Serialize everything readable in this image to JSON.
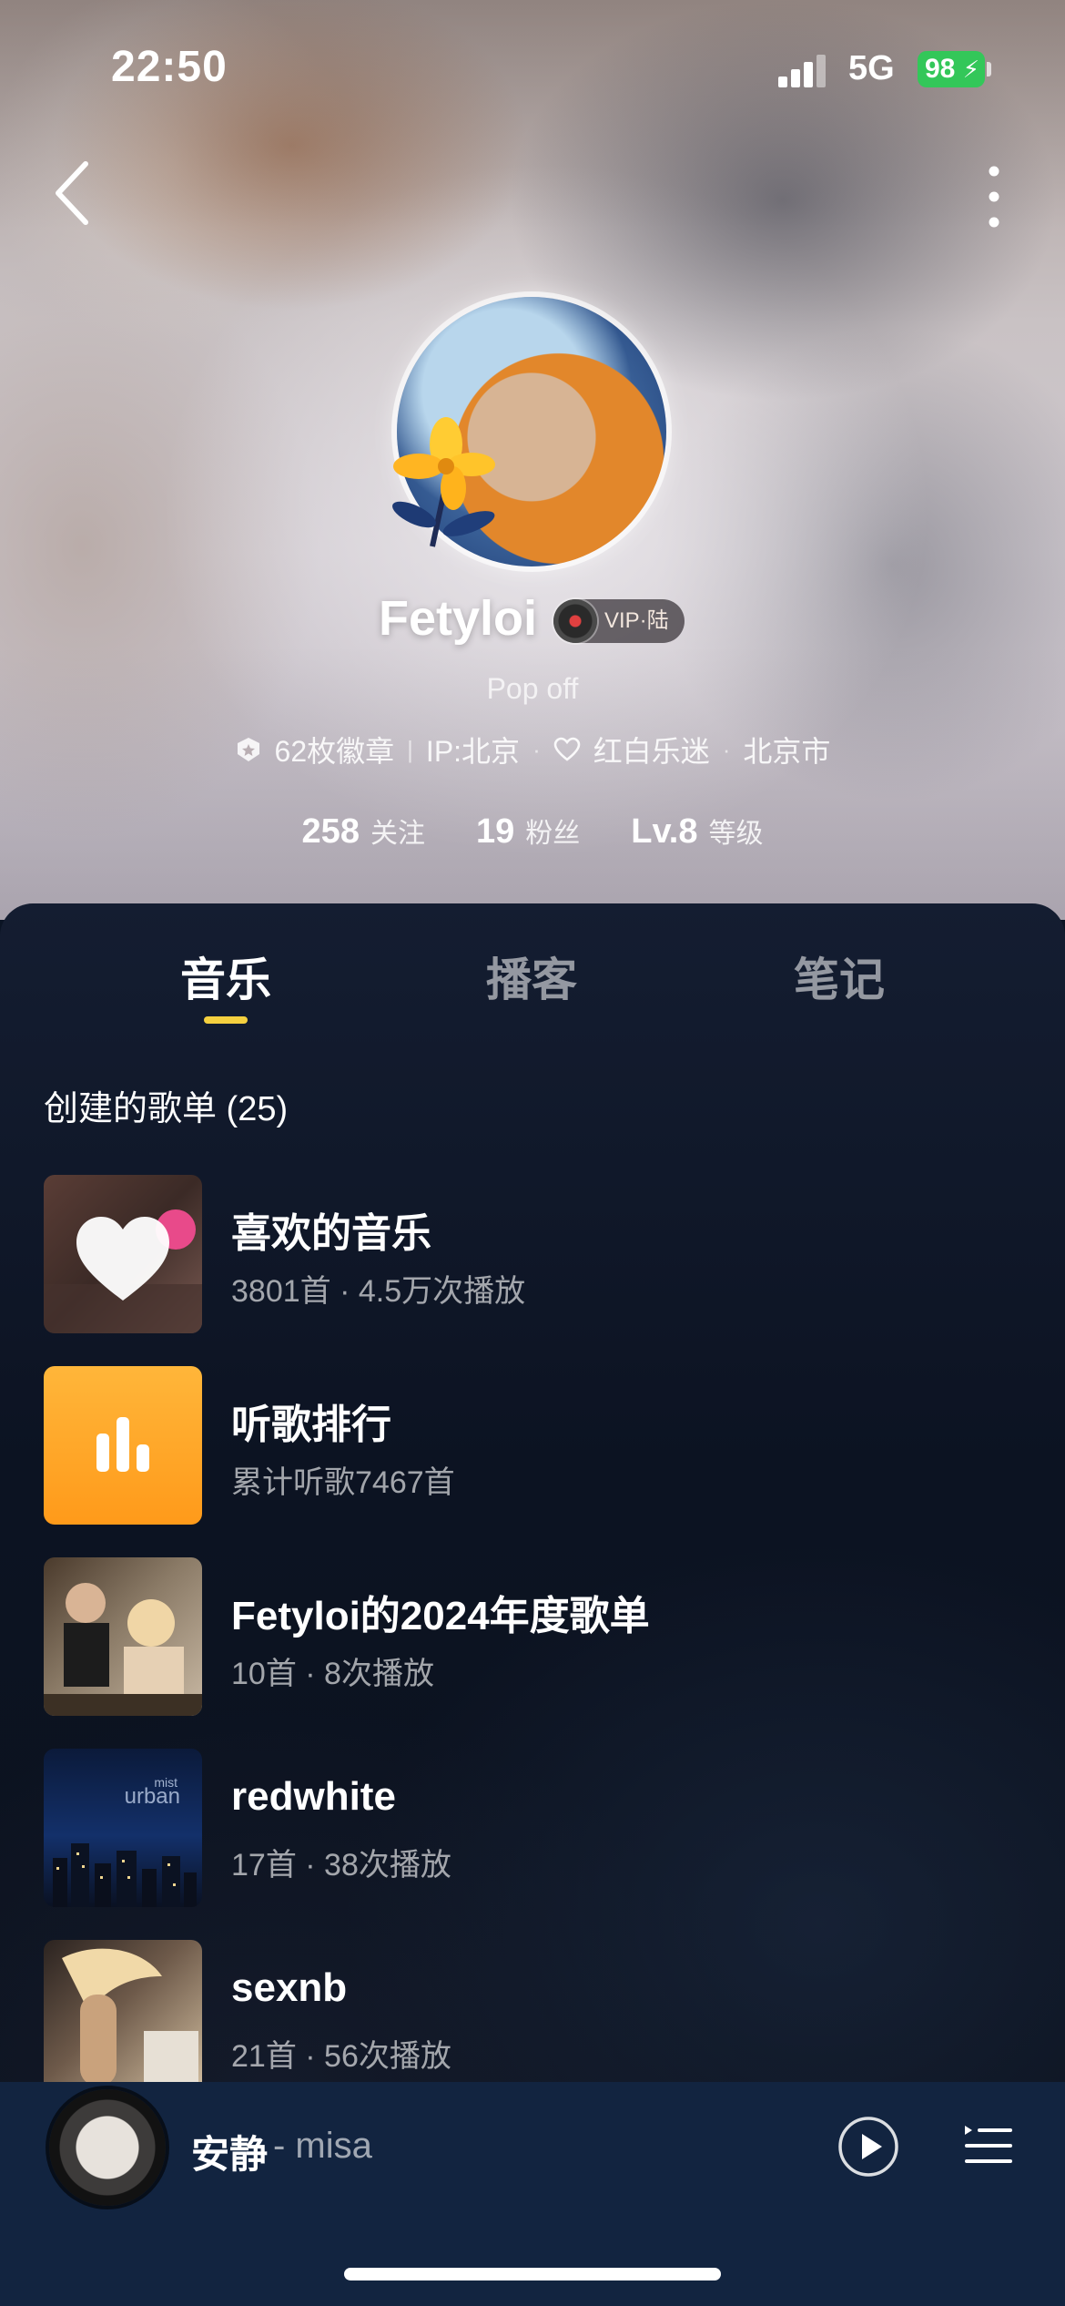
{
  "status_bar": {
    "time": "22:50",
    "network": "5G",
    "battery": "98"
  },
  "profile": {
    "username": "Fetyloi",
    "vip_label": "VIP·陆",
    "bio": "Pop off",
    "badges": "62枚徽章",
    "ip": "IP:北京",
    "fan_tag": "红白乐迷",
    "city": "北京市",
    "stats": {
      "following_count": "258",
      "following_label": "关注",
      "followers_count": "19",
      "followers_label": "粉丝",
      "level_value": "Lv.8",
      "level_label": "等级"
    }
  },
  "tabs": [
    {
      "label": "音乐",
      "active": true
    },
    {
      "label": "播客",
      "active": false
    },
    {
      "label": "笔记",
      "active": false
    }
  ],
  "section_title": "创建的歌单 (25)",
  "playlists": [
    {
      "name": "喜欢的音乐",
      "subtitle": "3801首 · 4.5万次播放"
    },
    {
      "name": "听歌排行",
      "subtitle": "累计听歌7467首"
    },
    {
      "name": "Fetyloi的2024年度歌单",
      "subtitle": "10首 · 8次播放"
    },
    {
      "name": "redwhite",
      "subtitle": "17首 · 38次播放"
    },
    {
      "name": "sexnb",
      "subtitle": "21首 · 56次播放"
    }
  ],
  "cover_texts": {
    "urban": "urban",
    "mist": "mist"
  },
  "mini_player": {
    "title": "安静",
    "artist": "- misa"
  },
  "colors": {
    "accent_underline": "#f4d03f",
    "battery_green": "#33c759",
    "ranking_orange": "#ffa726",
    "player_bar": "#122440"
  },
  "icons": {
    "back": "chevron-left-icon",
    "more": "vertical-ellipsis-icon",
    "badge": "badge-icon",
    "fan": "heart-icon",
    "play": "play-icon",
    "queue": "playlist-queue-icon"
  }
}
